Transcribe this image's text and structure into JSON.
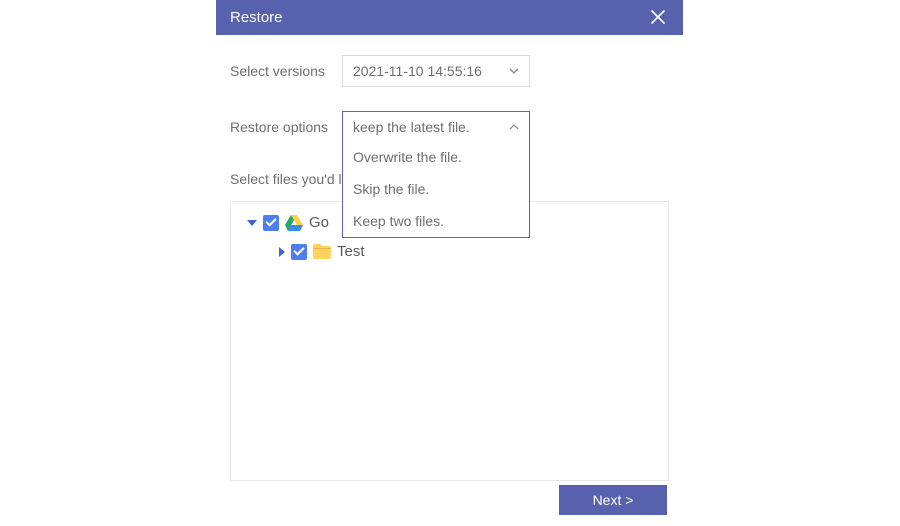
{
  "dialog": {
    "title": "Restore"
  },
  "form": {
    "versions_label": "Select versions",
    "versions_value": "2021-11-10 14:55:16",
    "options_label": "Restore options",
    "options_value": "keep the latest file.",
    "options_list": {
      "0": "Overwrite the file.",
      "1": "Skip the file.",
      "2": "Keep two files."
    },
    "files_label": "Select files you'd l"
  },
  "tree": {
    "node0": {
      "label": "Go"
    },
    "node1": {
      "label": "Test"
    }
  },
  "footer": {
    "next": "Next >"
  }
}
